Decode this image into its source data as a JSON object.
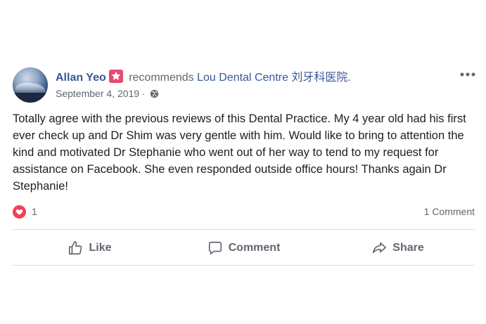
{
  "post": {
    "author": "Allan Yeo",
    "action": "recommends",
    "page": "Lou Dental Centre 刘牙科医院.",
    "date": "September 4, 2019 ·",
    "body": "Totally agree with the previous reviews of this Dental Practice. My 4 year old had his first ever check up and Dr Shim was very gentle with him. Would like to bring to attention the kind and motivated Dr Stephanie who went out of her way to tend to my request for assistance on Facebook. She even responded outside office hours! Thanks again Dr Stephanie!",
    "reaction_count": "1",
    "comment_count": "1 Comment"
  },
  "actions": {
    "like": "Like",
    "comment": "Comment",
    "share": "Share"
  },
  "icons": {
    "badge": "star-badge-icon",
    "privacy": "globe-icon",
    "more": "more-options-icon",
    "reaction": "heart-icon",
    "like": "thumbs-up-icon",
    "comment": "comment-bubble-icon",
    "share": "share-arrow-icon"
  },
  "colors": {
    "link": "#385898",
    "muted": "#606770",
    "badge": "#e64b6f",
    "heart": "#f33e58",
    "divider": "#dadde1"
  }
}
